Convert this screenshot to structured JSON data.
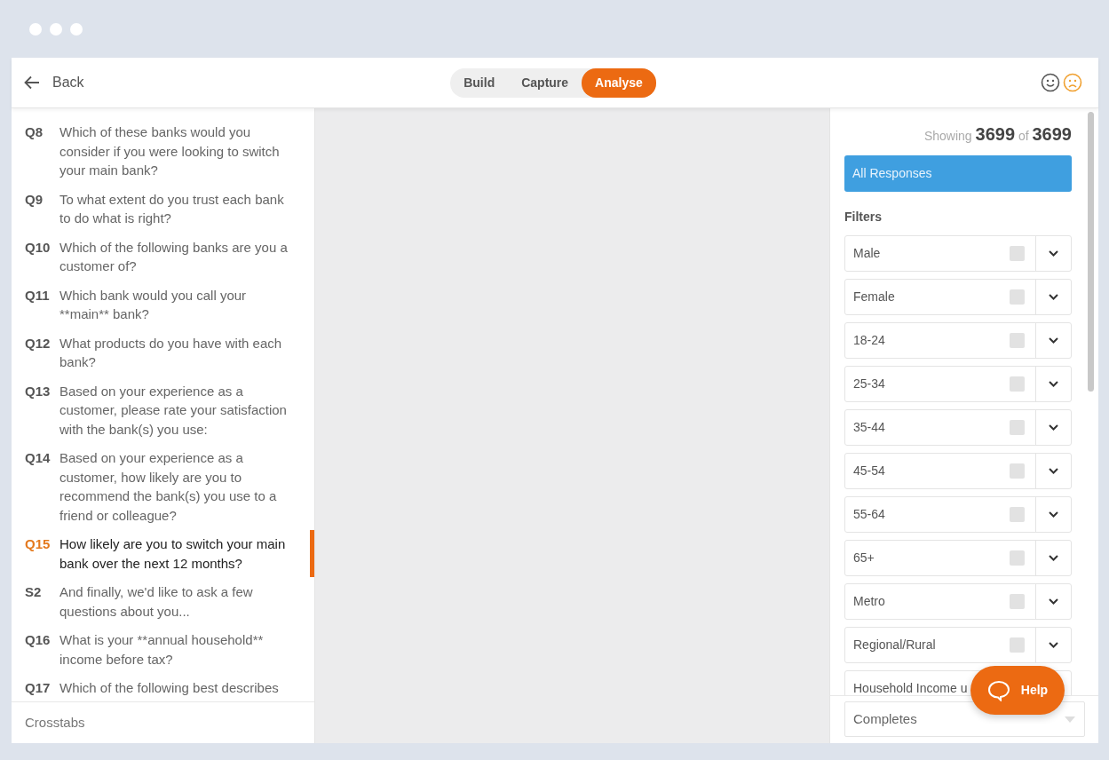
{
  "header": {
    "back_label": "Back",
    "tabs": [
      {
        "label": "Build",
        "selected": false
      },
      {
        "label": "Capture",
        "selected": false
      },
      {
        "label": "Analyse",
        "selected": true
      }
    ]
  },
  "questions": [
    {
      "number": "Q8",
      "text": "Which of these banks would you consider if you were looking to switch your main bank?",
      "selected": false
    },
    {
      "number": "Q9",
      "text": "To what extent do you trust each bank to do what is right?",
      "selected": false
    },
    {
      "number": "Q10",
      "text": "Which of the following banks are you a customer of?",
      "selected": false
    },
    {
      "number": "Q11",
      "text": "Which bank would you call your **main** bank?",
      "selected": false
    },
    {
      "number": "Q12",
      "text": "What products do you have with each bank?",
      "selected": false
    },
    {
      "number": "Q13",
      "text": "Based on your experience as a customer, please rate your satisfaction with the bank(s) you use:",
      "selected": false
    },
    {
      "number": "Q14",
      "text": "Based on your experience as a customer, how likely are you to recommend the bank(s) you use to a friend or colleague?",
      "selected": false
    },
    {
      "number": "Q15",
      "text": "How likely are you to switch your main bank over the next 12 months?",
      "selected": true
    },
    {
      "number": "S2",
      "text": "And finally, we'd like to ask a few questions about you...",
      "selected": false
    },
    {
      "number": "Q16",
      "text": "What is your **annual household** income before tax?",
      "selected": false
    },
    {
      "number": "Q17",
      "text": "Which of the following best describes",
      "selected": false
    }
  ],
  "crosstabs_label": "Crosstabs",
  "showing": {
    "label": "Showing",
    "count": "3699",
    "of": "of",
    "total": "3699"
  },
  "all_responses": "All Responses",
  "filters_title": "Filters",
  "filters": [
    {
      "label": "Male",
      "checked": false
    },
    {
      "label": "Female",
      "checked": false
    },
    {
      "label": "18-24",
      "checked": false
    },
    {
      "label": "25-34",
      "checked": false
    },
    {
      "label": "35-44",
      "checked": false
    },
    {
      "label": "45-54",
      "checked": false
    },
    {
      "label": "55-64",
      "checked": false
    },
    {
      "label": "65+",
      "checked": false
    },
    {
      "label": "Metro",
      "checked": false
    },
    {
      "label": "Regional/Rural",
      "checked": false
    },
    {
      "label": "Household Income u"
    }
  ],
  "completes_select": "Completes",
  "help_button": "Help"
}
